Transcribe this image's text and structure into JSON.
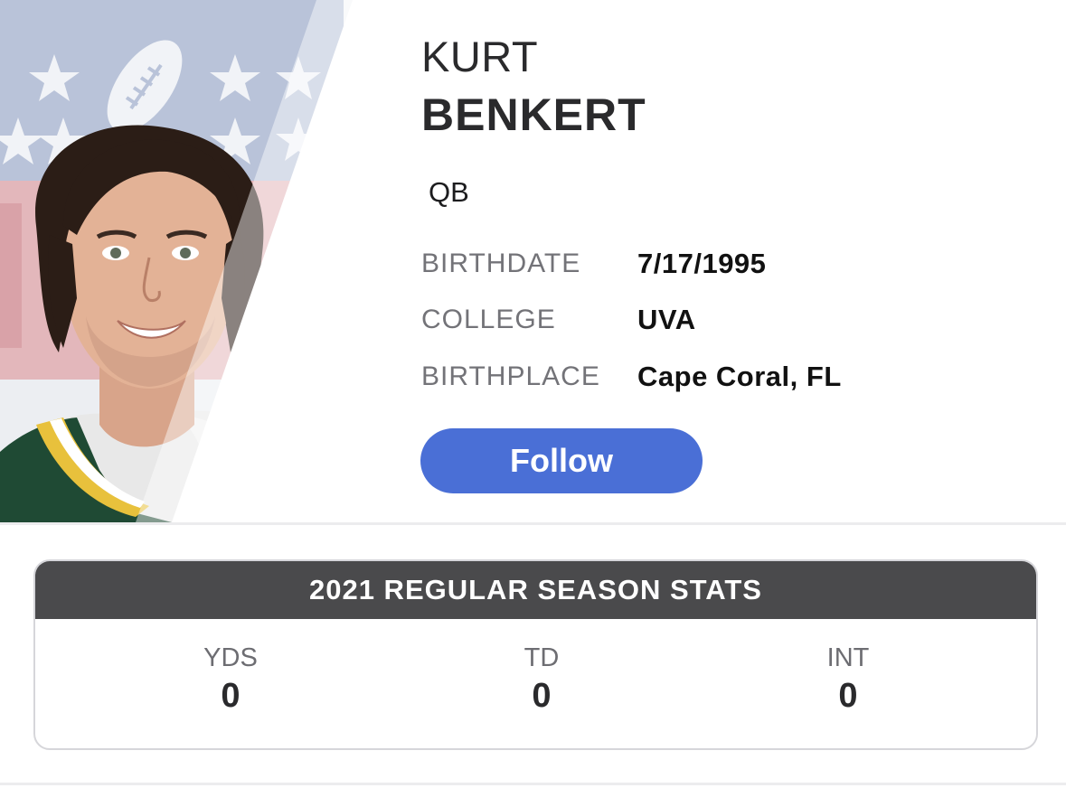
{
  "player": {
    "first_name": "KURT",
    "last_name": "BENKERT",
    "position": "QB",
    "photo_description": "player-headshot"
  },
  "info": {
    "birthdate_label": "BIRTHDATE",
    "birthdate_value": "7/17/1995",
    "college_label": "COLLEGE",
    "college_value": "UVA",
    "birthplace_label": "BIRTHPLACE",
    "birthplace_value": "Cape Coral, FL"
  },
  "actions": {
    "follow_label": "Follow"
  },
  "stats": {
    "title": "2021 REGULAR SEASON STATS",
    "columns": [
      {
        "label": "YDS",
        "value": "0"
      },
      {
        "label": "TD",
        "value": "0"
      },
      {
        "label": "INT",
        "value": "0"
      }
    ]
  },
  "colors": {
    "accent": "#4a6fd6",
    "stats_header_bg": "#4a4a4c",
    "label_gray": "#737378",
    "text_dark": "#2a2a2c",
    "shield_blue": "#b7c2d9",
    "shield_red": "#e3b4b8",
    "jersey_green": "#1f4a34",
    "jersey_gold": "#e8c13c"
  }
}
